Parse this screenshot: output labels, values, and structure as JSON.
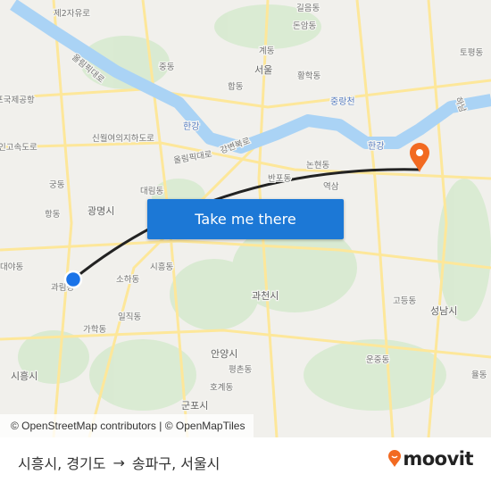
{
  "map": {
    "labels": [
      "제2자유로",
      "중동",
      "올림픽대로",
      "포국제공항",
      "합동",
      "서울",
      "계동",
      "돈암동",
      "길음동",
      "황학동",
      "중랑천",
      "한강",
      "신월여의지하도로",
      "인고속도로",
      "올림픽대로",
      "강변북로",
      "궁동",
      "대림동",
      "광명시",
      "항동",
      "논현동",
      "반포동",
      "역삼",
      "한강",
      "대야동",
      "과림동",
      "소하동",
      "시흥동",
      "일직동",
      "가학동",
      "과천시",
      "안양시",
      "평촌동",
      "호계동",
      "군포시",
      "시흥시",
      "고등동",
      "성남시",
      "운중동",
      "율동",
      "토평동",
      "하남"
    ],
    "colors": {
      "water": "#aad3f5",
      "road": "#fde79a",
      "park": "#d7ead0",
      "route": "#222222",
      "pin": "#f26a21"
    }
  },
  "cta": {
    "label": "Take me there"
  },
  "attribution": "© OpenStreetMap contributors | © OpenMapTiles",
  "footer": {
    "origin": "시흥시, 경기도",
    "arrow": "→",
    "destination": "송파구, 서울시",
    "brand": "moovit"
  }
}
